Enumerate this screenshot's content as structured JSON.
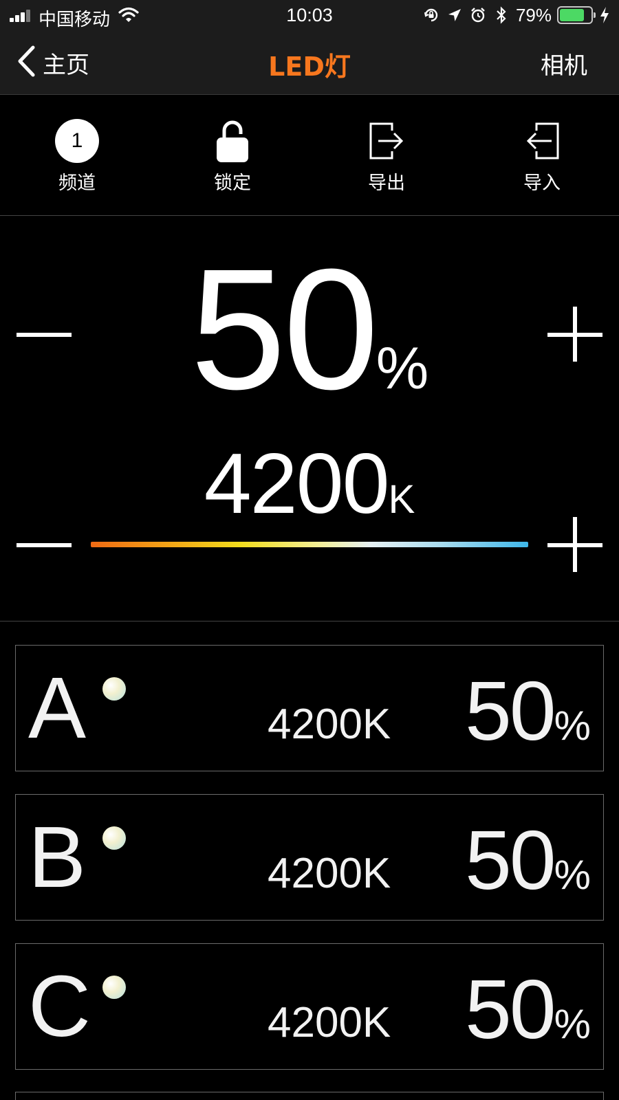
{
  "status_bar": {
    "carrier": "中国移动",
    "time": "10:03",
    "battery_percent": "79%",
    "battery_level": 0.79,
    "battery_color": "#4cd964",
    "icons": [
      "signal-icon",
      "wifi-icon",
      "orientation-lock-icon",
      "location-icon",
      "alarm-icon",
      "bluetooth-icon",
      "battery-icon",
      "charging-icon"
    ]
  },
  "nav": {
    "back_label": "主页",
    "title": "LED灯",
    "right_label": "相机",
    "title_color": "#f7771e"
  },
  "toolbar": {
    "channel_number": "1",
    "channel_label": "频道",
    "lock_label": "锁定",
    "export_label": "导出",
    "import_label": "导入"
  },
  "control": {
    "brightness_value": "50",
    "brightness_unit": "%",
    "color_temp_value": "4200",
    "color_temp_unit": "K"
  },
  "channels": [
    {
      "letter": "A",
      "color_temp": "4200K",
      "brightness": "50",
      "unit": "%"
    },
    {
      "letter": "B",
      "color_temp": "4200K",
      "brightness": "50",
      "unit": "%"
    },
    {
      "letter": "C",
      "color_temp": "4200K",
      "brightness": "50",
      "unit": "%"
    }
  ]
}
